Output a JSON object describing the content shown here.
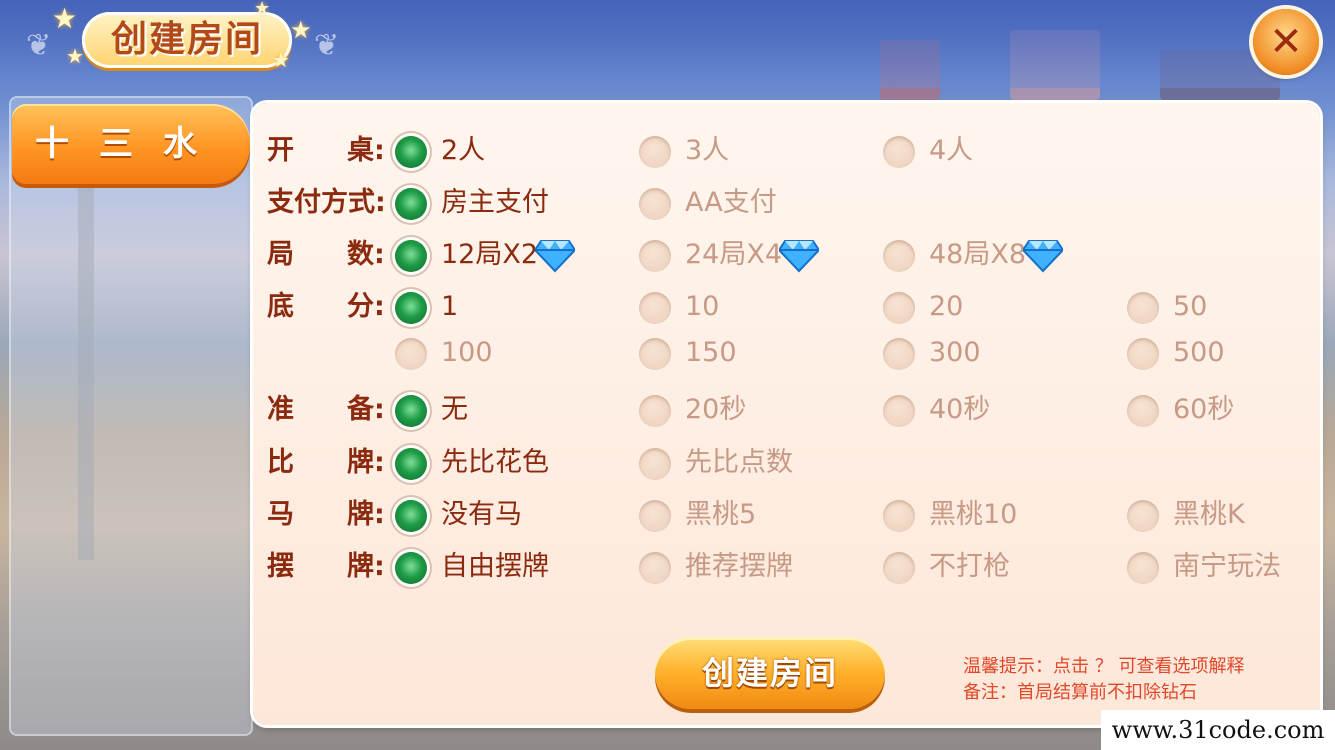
{
  "header": {
    "title": "创建房间",
    "close_glyph": "✕"
  },
  "sidebar": {
    "game_tab": "十三水"
  },
  "colors": {
    "selected_green": "#1f9c47",
    "label_red": "#8c2a10",
    "tab_orange": "#ff9624",
    "tip_red": "#e0482a"
  },
  "options": {
    "tables": {
      "label": [
        "开",
        "桌:"
      ],
      "items": [
        {
          "text": "2人",
          "selected": true
        },
        {
          "text": "3人",
          "selected": false
        },
        {
          "text": "4人",
          "selected": false
        }
      ]
    },
    "payment": {
      "label": [
        "支付方式:",
        ""
      ],
      "items": [
        {
          "text": "房主支付",
          "selected": true
        },
        {
          "text": "AA支付",
          "selected": false
        }
      ]
    },
    "rounds": {
      "label": [
        "局",
        "数:"
      ],
      "items": [
        {
          "text": "12局X2",
          "selected": true,
          "icon": "diamond-icon"
        },
        {
          "text": "24局X4",
          "selected": false,
          "icon": "diamond-icon"
        },
        {
          "text": "48局X8",
          "selected": false,
          "icon": "diamond-icon"
        }
      ]
    },
    "base": {
      "label": [
        "底",
        "分:"
      ],
      "items": [
        {
          "text": "1",
          "selected": true
        },
        {
          "text": "10",
          "selected": false
        },
        {
          "text": "20",
          "selected": false
        },
        {
          "text": "50",
          "selected": false
        },
        {
          "text": "100",
          "selected": false
        },
        {
          "text": "150",
          "selected": false
        },
        {
          "text": "300",
          "selected": false
        },
        {
          "text": "500",
          "selected": false
        }
      ]
    },
    "ready": {
      "label": [
        "准",
        "备:"
      ],
      "items": [
        {
          "text": "无",
          "selected": true
        },
        {
          "text": "20秒",
          "selected": false
        },
        {
          "text": "40秒",
          "selected": false
        },
        {
          "text": "60秒",
          "selected": false
        }
      ]
    },
    "compare": {
      "label": [
        "比",
        "牌:"
      ],
      "items": [
        {
          "text": "先比花色",
          "selected": true
        },
        {
          "text": "先比点数",
          "selected": false
        }
      ]
    },
    "horse": {
      "label": [
        "马",
        "牌:"
      ],
      "items": [
        {
          "text": "没有马",
          "selected": true
        },
        {
          "text": "黑桃5",
          "selected": false
        },
        {
          "text": "黑桃10",
          "selected": false
        },
        {
          "text": "黑桃K",
          "selected": false
        }
      ]
    },
    "arrange": {
      "label": [
        "摆",
        "牌:"
      ],
      "items": [
        {
          "text": "自由摆牌",
          "selected": true
        },
        {
          "text": "推荐摆牌",
          "selected": false
        },
        {
          "text": "不打枪",
          "selected": false
        },
        {
          "text": "南宁玩法",
          "selected": false
        }
      ]
    }
  },
  "footer": {
    "create_label": "创建房间",
    "tip1": "温馨提示：点击 ？ 可查看选项解释",
    "tip2": "备注：首局结算前不扣除钻石"
  },
  "watermark": "www.31code.com"
}
